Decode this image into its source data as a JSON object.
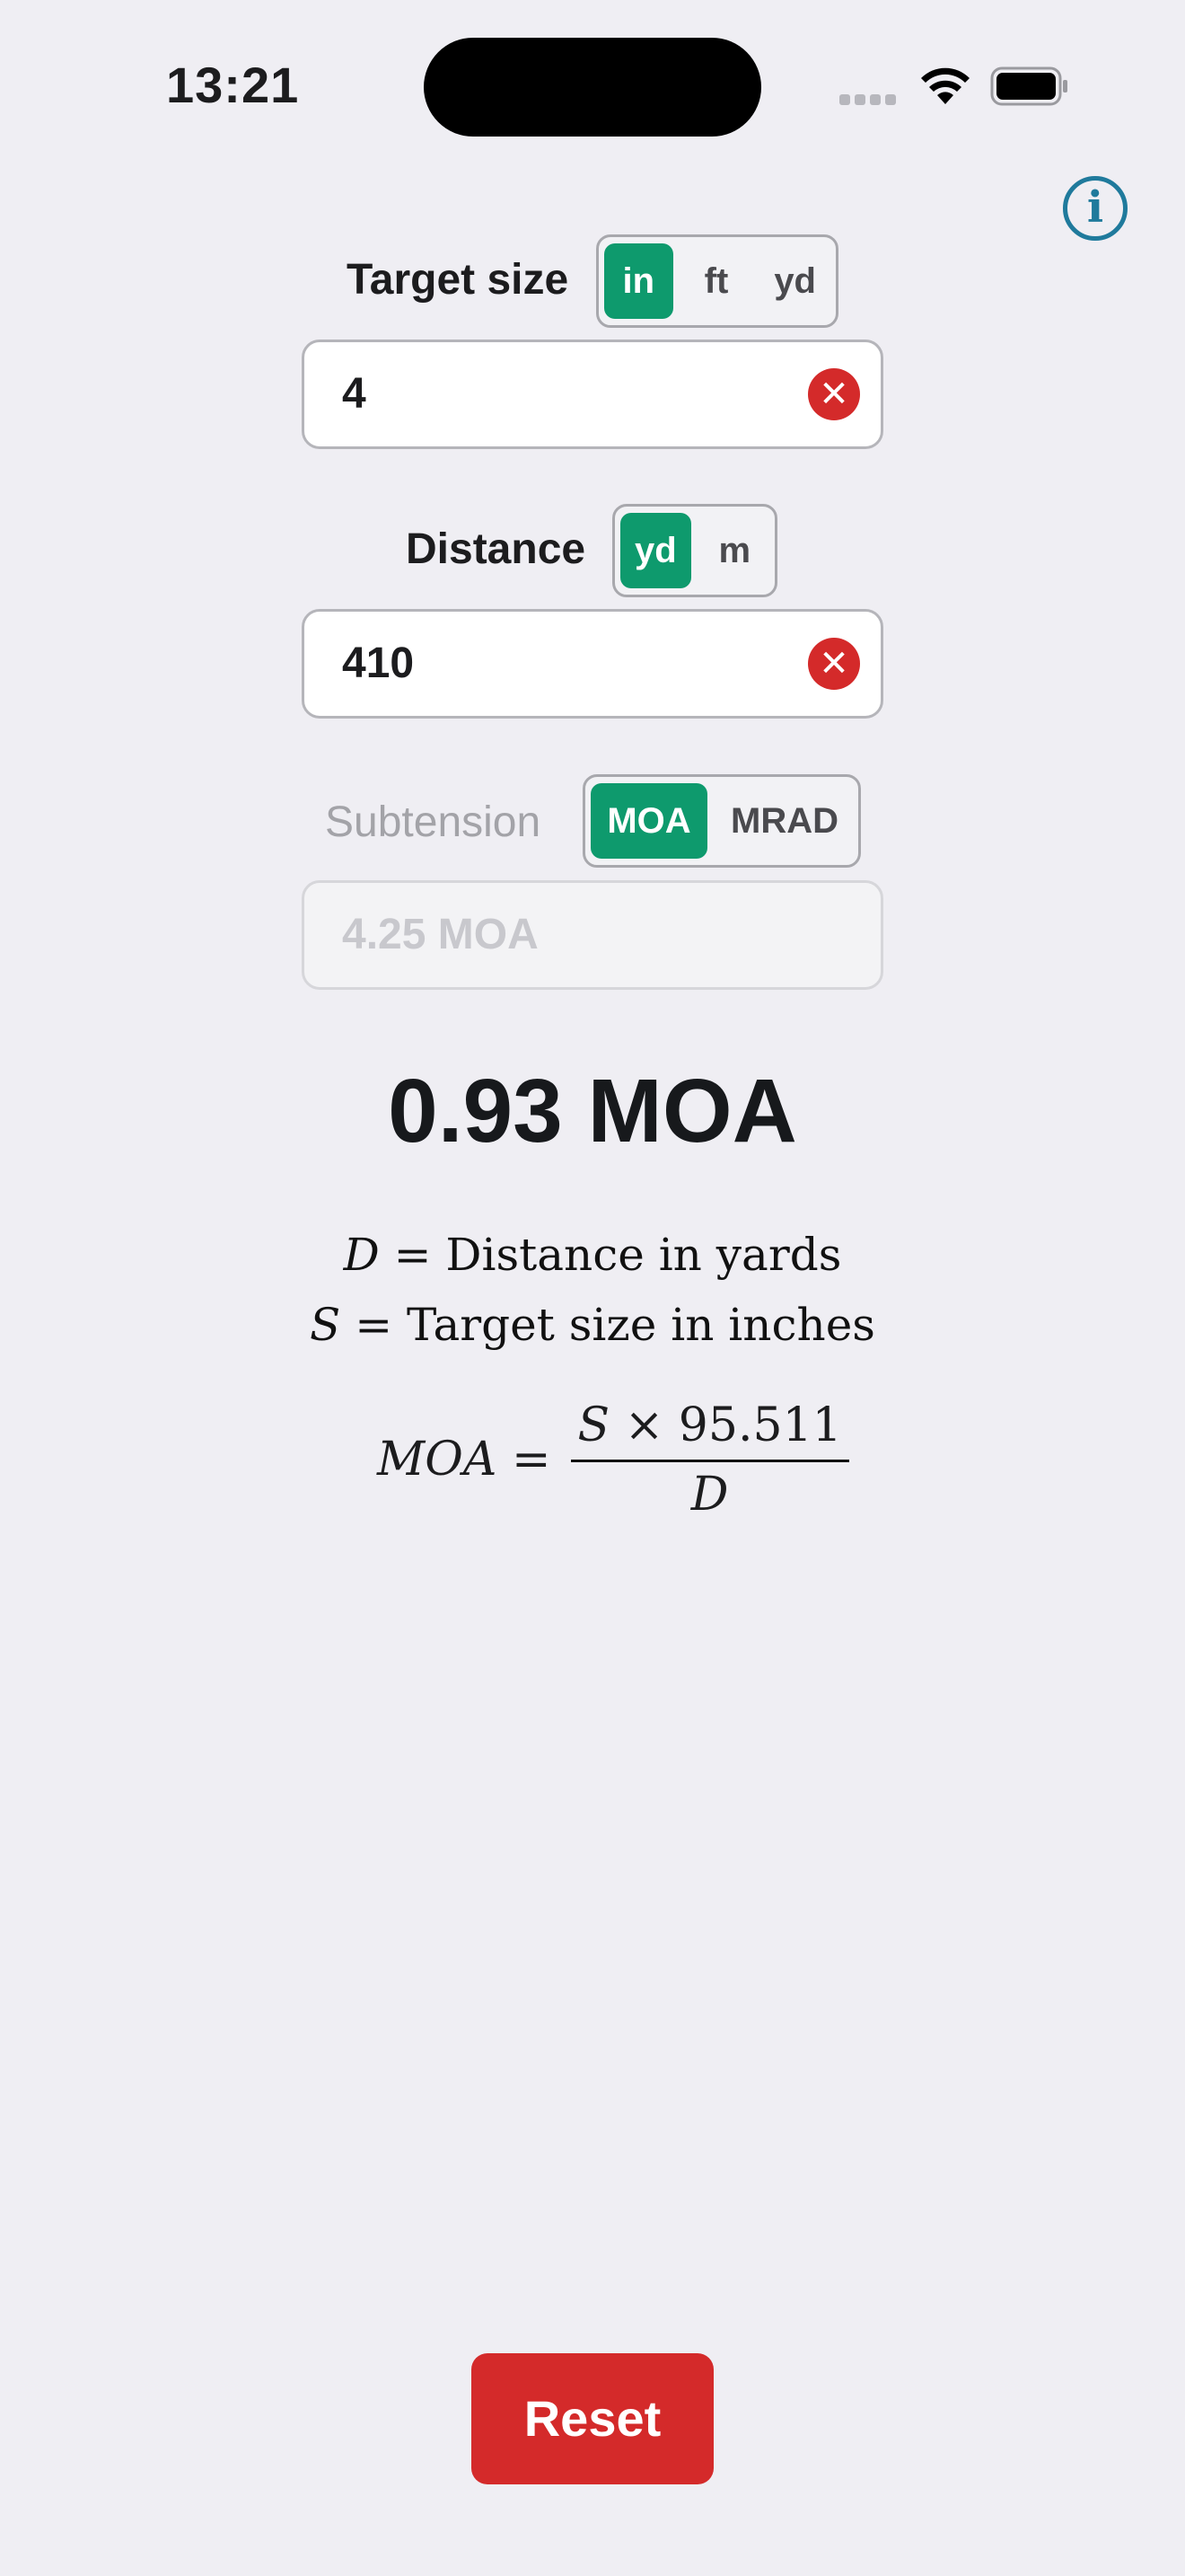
{
  "status_bar": {
    "time": "13:21"
  },
  "target_size": {
    "label": "Target size",
    "units": [
      "in",
      "ft",
      "yd"
    ],
    "selected_unit": "in",
    "value": "4"
  },
  "distance": {
    "label": "Distance",
    "units": [
      "yd",
      "m"
    ],
    "selected_unit": "yd",
    "value": "410"
  },
  "subtension": {
    "label": "Subtension",
    "units": [
      "MOA",
      "MRAD"
    ],
    "selected_unit": "MOA",
    "placeholder": "4.25 MOA"
  },
  "result": "0.93 MOA",
  "formula": {
    "legend_d_var": "D",
    "legend_d_text": "Distance in yards",
    "legend_s_var": "S",
    "legend_s_text": "Target size in inches",
    "lhs": "MOA",
    "numerator_var": "S",
    "numerator_rest": "× 95.511",
    "denominator": "D"
  },
  "reset_label": "Reset",
  "colors": {
    "accent_green": "#0e9a6d",
    "danger_red": "#d42a2a",
    "info_blue": "#1f7a9c"
  }
}
